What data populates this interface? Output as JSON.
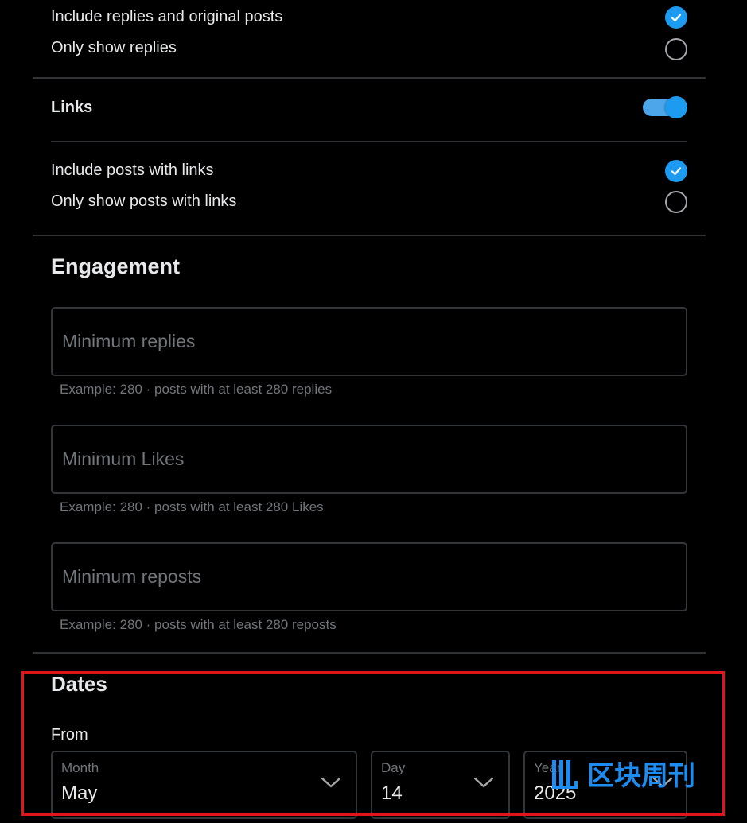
{
  "replies": {
    "include_label": "Include replies and original posts",
    "only_label": "Only show replies",
    "include_checked": true,
    "only_checked": false
  },
  "links": {
    "title": "Links",
    "toggle_on": true,
    "include_label": "Include posts with links",
    "only_label": "Only show posts with links",
    "include_checked": true,
    "only_checked": false
  },
  "engagement": {
    "title": "Engagement",
    "fields": [
      {
        "placeholder": "Minimum replies",
        "value": "",
        "hint": "Example: 280 · posts with at least 280 replies"
      },
      {
        "placeholder": "Minimum Likes",
        "value": "",
        "hint": "Example: 280 · posts with at least 280 Likes"
      },
      {
        "placeholder": "Minimum reposts",
        "value": "",
        "hint": "Example: 280 · posts with at least 280 reposts"
      }
    ]
  },
  "dates": {
    "title": "Dates",
    "from_label": "From",
    "month": {
      "label": "Month",
      "value": "May"
    },
    "day": {
      "label": "Day",
      "value": "14"
    },
    "year": {
      "label": "Year",
      "value": "2025"
    }
  },
  "watermark": {
    "text": "区块周刊"
  },
  "colors": {
    "background": "#000000",
    "accent": "#1d9bf0",
    "toggle_track": "#4ea6ea",
    "divider": "#2f3336",
    "muted_text": "#71767b",
    "highlight_box": "#e0141a"
  }
}
